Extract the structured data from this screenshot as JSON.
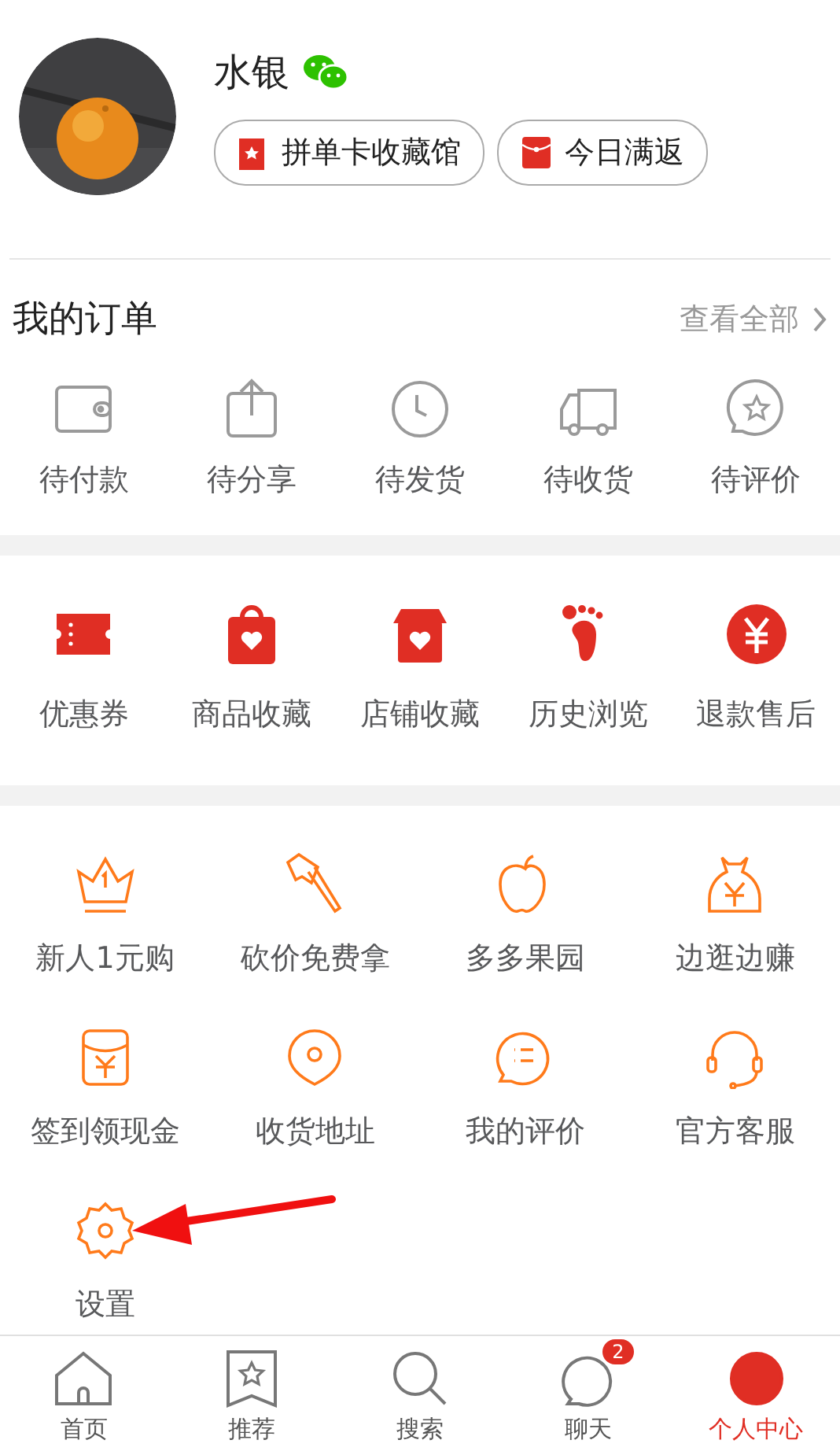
{
  "profile": {
    "name": "水银",
    "buttons": [
      "拼单卡收藏馆",
      "今日满返"
    ]
  },
  "orders": {
    "title": "我的订单",
    "view_all": "查看全部",
    "items": [
      "待付款",
      "待分享",
      "待发货",
      "待收货",
      "待评价"
    ]
  },
  "favorites": [
    "优惠券",
    "商品收藏",
    "店铺收藏",
    "历史浏览",
    "退款售后"
  ],
  "services": [
    "新人1元购",
    "砍价免费拿",
    "多多果园",
    "边逛边赚",
    "签到领现金",
    "收货地址",
    "我的评价",
    "官方客服",
    "设置"
  ],
  "tabs": [
    {
      "label": "首页",
      "selected": false
    },
    {
      "label": "推荐",
      "selected": false
    },
    {
      "label": "搜索",
      "selected": false
    },
    {
      "label": "聊天",
      "selected": false,
      "badge": "2"
    },
    {
      "label": "个人中心",
      "selected": true
    }
  ]
}
